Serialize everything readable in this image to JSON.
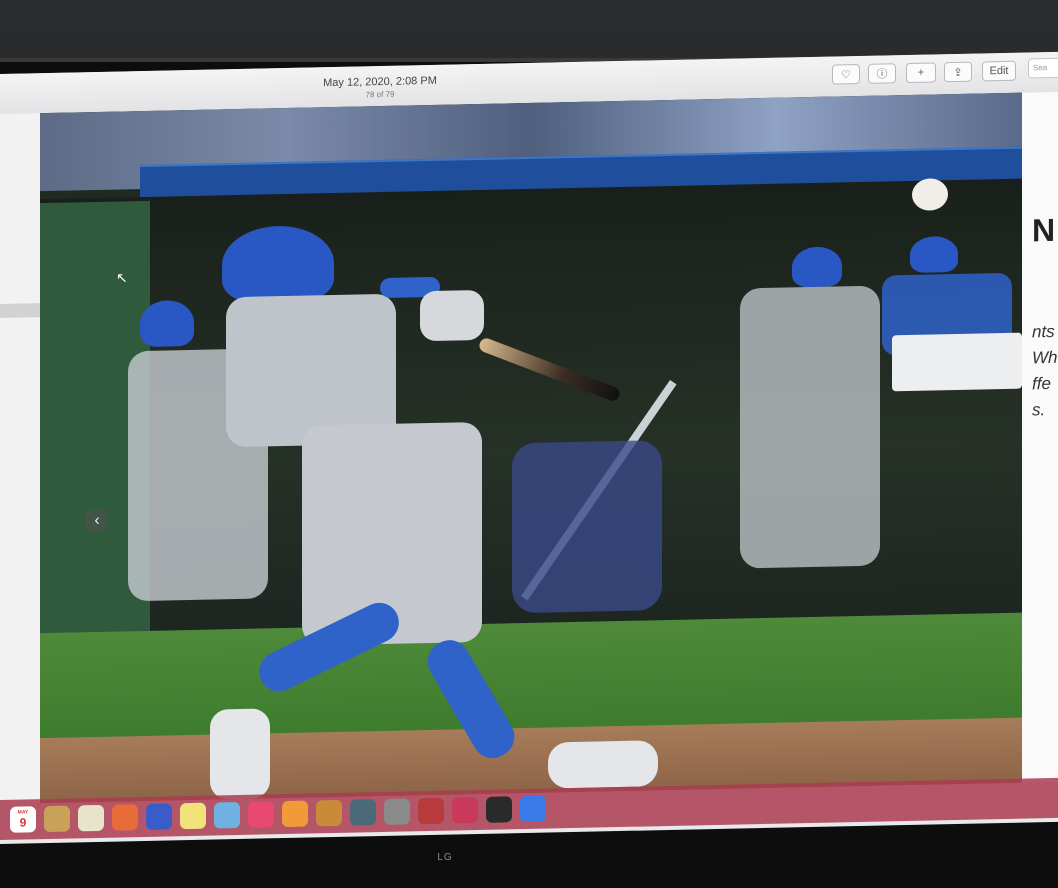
{
  "window": {
    "date": "May 12, 2020, 2:08 PM",
    "counter": "78 of 79",
    "toolbar": {
      "favorite_icon": "heart-icon",
      "info_icon": "info-icon",
      "add_label": "+",
      "share_icon": "share-icon",
      "edit_label": "Edit"
    },
    "search_placeholder": "Sea"
  },
  "article_fragments": [
    "nts",
    "Wh",
    "ffe",
    "s."
  ],
  "article_big_letter": "N",
  "photo": {
    "prev_icon": "chevron-left-icon",
    "prev_glyph": "‹",
    "cursor_glyph": "↖"
  },
  "dock": {
    "calendar_month": "MAY",
    "calendar_day": "9",
    "apps": [
      {
        "name": "finder",
        "color": "#c9a157"
      },
      {
        "name": "notes",
        "color": "#e8e4c9"
      },
      {
        "name": "photos",
        "color": "#e86b3a"
      },
      {
        "name": "imovie",
        "color": "#3a5cc9"
      },
      {
        "name": "stickies",
        "color": "#f2e27a"
      },
      {
        "name": "preview",
        "color": "#6fb1e0"
      },
      {
        "name": "music",
        "color": "#e84a6f"
      },
      {
        "name": "books",
        "color": "#f29a3a"
      },
      {
        "name": "garageband",
        "color": "#c98a3a"
      },
      {
        "name": "time-machine",
        "color": "#4a6a7a"
      },
      {
        "name": "system-preferences",
        "color": "#8a8a8a"
      },
      {
        "name": "dictionary",
        "color": "#b83a3a"
      },
      {
        "name": "photo-booth",
        "color": "#c93a5a"
      },
      {
        "name": "activity-monitor",
        "color": "#2a2a2a"
      },
      {
        "name": "app-store",
        "color": "#3a7ae8"
      }
    ]
  },
  "monitor_brand": "LG"
}
